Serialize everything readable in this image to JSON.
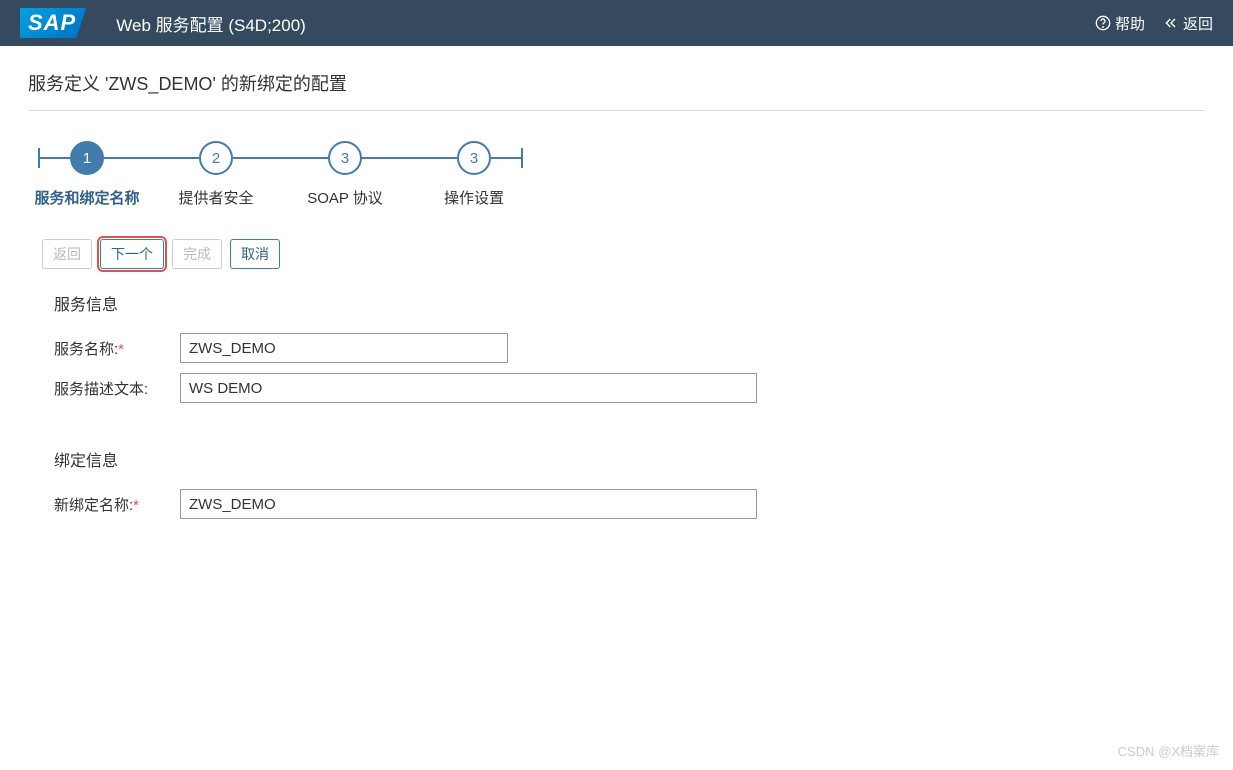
{
  "header": {
    "logo_text": "SAP",
    "title": "Web 服务配置 (S4D;200)",
    "help_label": "帮助",
    "back_label": "返回"
  },
  "subtitle": "服务定义 'ZWS_DEMO' 的新绑定的配置",
  "wizard": {
    "steps": [
      {
        "num": "1",
        "label": "服务和绑定名称",
        "active": true
      },
      {
        "num": "2",
        "label": "提供者安全",
        "active": false
      },
      {
        "num": "3",
        "label": "SOAP 协议",
        "active": false
      },
      {
        "num": "3",
        "label": "操作设置",
        "active": false
      }
    ]
  },
  "buttons": {
    "back": "返回",
    "next": "下一个",
    "finish": "完成",
    "cancel": "取消"
  },
  "sections": {
    "service_info": {
      "title": "服务信息",
      "service_name_label": "服务名称:",
      "service_name_value": "ZWS_DEMO",
      "service_desc_label": "服务描述文本:",
      "service_desc_value": "WS DEMO"
    },
    "binding_info": {
      "title": "绑定信息",
      "binding_name_label": "新绑定名称:",
      "binding_name_value": "ZWS_DEMO"
    }
  },
  "watermark": "CSDN @X档案库"
}
